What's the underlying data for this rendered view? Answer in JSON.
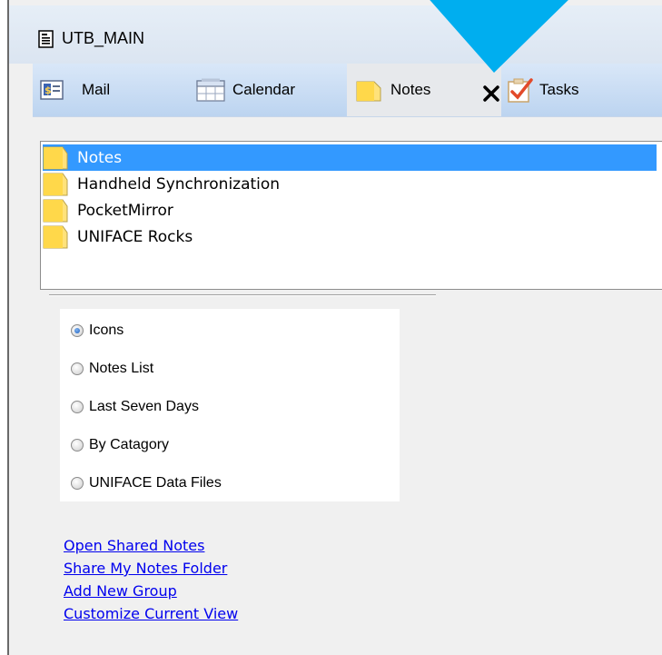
{
  "window": {
    "title": "UTB_MAIN"
  },
  "tabs": [
    {
      "label": "Mail",
      "icon": "address-card-icon",
      "active": false
    },
    {
      "label": "Calendar",
      "icon": "calendar-icon",
      "active": false
    },
    {
      "label": "Notes",
      "icon": "notes-folder-icon",
      "active": true
    },
    {
      "label": "Tasks",
      "icon": "tasks-checklist-icon",
      "active": false
    }
  ],
  "folders": [
    {
      "label": "Notes",
      "selected": true
    },
    {
      "label": "Handheld Synchronization",
      "selected": false
    },
    {
      "label": "PocketMirror",
      "selected": false
    },
    {
      "label": "UNIFACE Rocks",
      "selected": false
    }
  ],
  "view_options": [
    {
      "label": "Icons",
      "checked": true
    },
    {
      "label": "Notes List",
      "checked": false
    },
    {
      "label": "Last Seven Days",
      "checked": false
    },
    {
      "label": "By Catagory",
      "checked": false
    },
    {
      "label": "UNIFACE Data Files",
      "checked": false
    }
  ],
  "links": [
    "Open Shared Notes",
    "Share My Notes Folder",
    "Add New Group",
    "Customize Current View"
  ],
  "colors": {
    "selection": "#3399ff",
    "pointer_arrow": "#00aeef",
    "link": "#0000ee"
  }
}
